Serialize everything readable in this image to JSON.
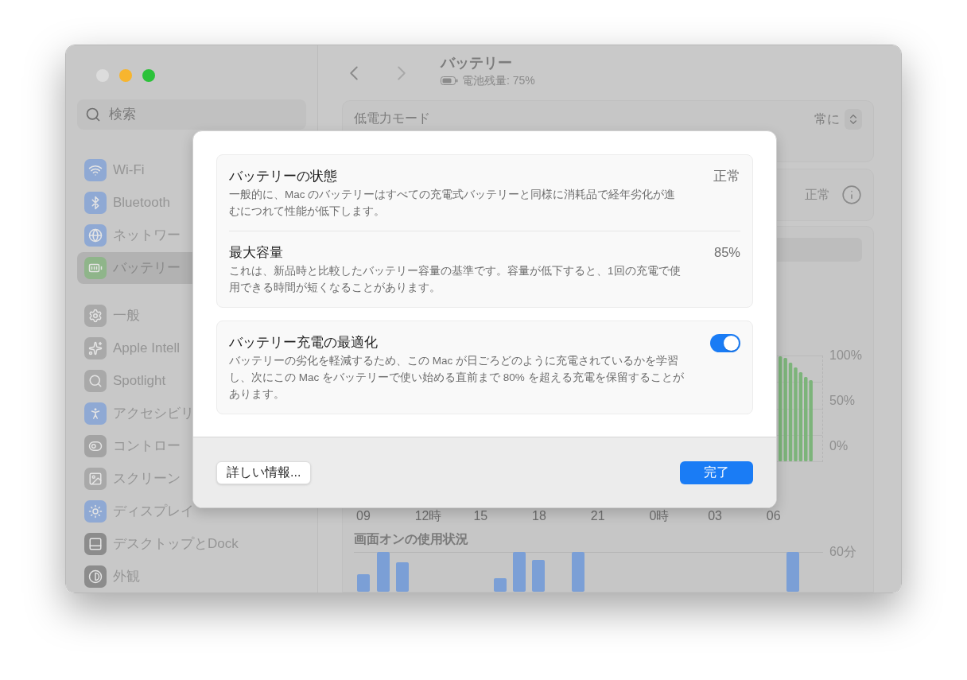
{
  "sidebar": {
    "search": {
      "placeholder": "検索"
    },
    "groups": [
      {
        "items": [
          {
            "label": "Wi-Fi",
            "selected": false,
            "color": "#8fa9d4"
          },
          {
            "label": "Bluetooth",
            "selected": false,
            "color": "#8fa9d4"
          },
          {
            "label": "ネットワー",
            "selected": false,
            "color": "#8fa9d4"
          },
          {
            "label": "バッテリー",
            "selected": true,
            "color": "#8fb58a"
          }
        ]
      },
      {
        "items": [
          {
            "label": "一般",
            "selected": false,
            "color": "#a9a9a9"
          },
          {
            "label": "Apple Intell",
            "selected": false,
            "color": "#a9a9a9"
          },
          {
            "label": "Spotlight",
            "selected": false,
            "color": "#a9a9a9"
          },
          {
            "label": "アクセシビリ",
            "selected": false,
            "color": "#8fa9d4"
          },
          {
            "label": "コントロー",
            "selected": false,
            "color": "#a3a3a3"
          },
          {
            "label": "スクリーン",
            "selected": false,
            "color": "#a9a9a9"
          },
          {
            "label": "ディスプレイ",
            "selected": false,
            "color": "#8fa9d4"
          },
          {
            "label": "デスクトップとDock",
            "selected": false,
            "color": "#8c8c8c"
          },
          {
            "label": "外観",
            "selected": false,
            "color": "#8c8c8c"
          }
        ]
      }
    ]
  },
  "header": {
    "title": "バッテリー",
    "subtitle": "電池残量: 75%"
  },
  "settings": {
    "low_power_mode": {
      "label": "低電力モード",
      "value": "常に"
    },
    "health_row": {
      "value": "正常"
    }
  },
  "battery_chart": {
    "yticks": [
      "100%",
      "50%",
      "0%"
    ],
    "xticks": [
      "09",
      "12時",
      "15",
      "18",
      "21",
      "0時",
      "03",
      "06"
    ]
  },
  "usage_chart": {
    "title": "画面オンの使用状況",
    "ytick": "60分"
  },
  "dialog": {
    "sections": [
      {
        "items": [
          {
            "kind": "value",
            "title": "バッテリーの状態",
            "description": "一般的に、Mac のバッテリーはすべての充電式バッテリーと同様に消耗品で経年劣化が進むにつれて性能が低下します。",
            "value": "正常"
          },
          {
            "kind": "value",
            "title": "最大容量",
            "description": "これは、新品時と比較したバッテリー容量の基準です。容量が低下すると、1回の充電で使用できる時間が短くなることがあります。",
            "value": "85%"
          }
        ]
      },
      {
        "items": [
          {
            "kind": "toggle",
            "title": "バッテリー充電の最適化",
            "description": "バッテリーの劣化を軽減するため、この Mac が日ごろどのように充電されているかを学習し、次にこの Mac をバッテリーで使い始める直前まで 80% を超える充電を保留することがあります。",
            "on": true
          }
        ]
      }
    ],
    "buttons": [
      {
        "label": "詳しい情報...",
        "kind": "secondary"
      },
      {
        "label": "完了",
        "kind": "primary"
      }
    ]
  }
}
